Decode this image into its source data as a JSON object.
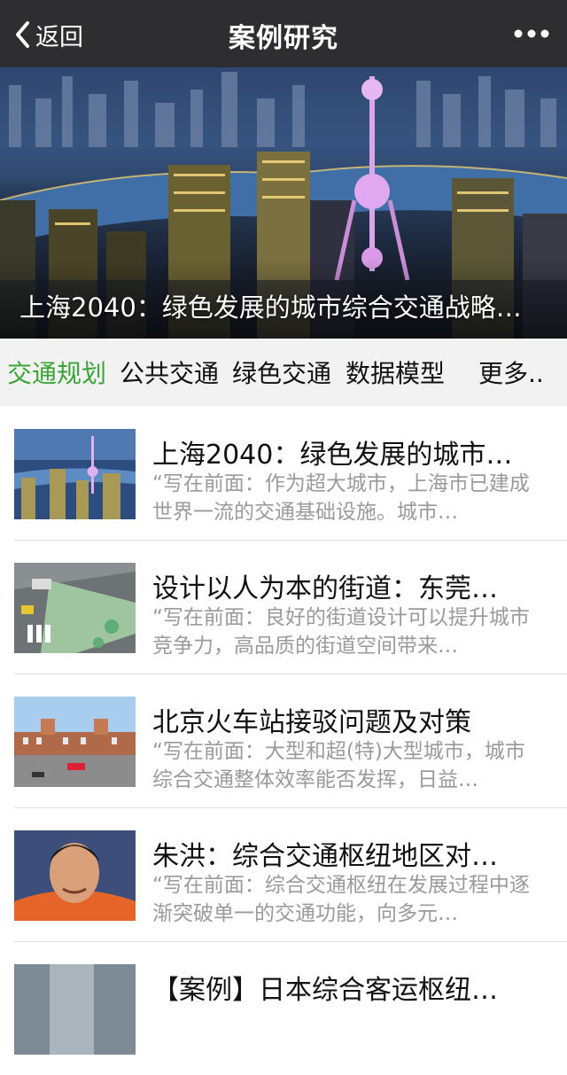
{
  "nav": {
    "back_label": "返回",
    "title": "案例研究",
    "icons": {
      "back": "chevron-left-icon",
      "more": "more-dots-icon"
    }
  },
  "banner": {
    "caption": "上海2040：绿色发展的城市综合交通战略…"
  },
  "tabs": [
    {
      "label": "交通规划",
      "active": true
    },
    {
      "label": "公共交通",
      "active": false
    },
    {
      "label": "绿色交通",
      "active": false
    },
    {
      "label": "数据模型",
      "active": false
    },
    {
      "label": "更多..",
      "active": false
    }
  ],
  "articles": [
    {
      "title": "上海2040：绿色发展的城市…",
      "summary": "“写在前面：作为超大城市，上海市已建成世界一流的交通基础设施。城市…"
    },
    {
      "title": "设计以人为本的街道：东莞…",
      "summary": "“写在前面：良好的街道设计可以提升城市竞争力，高品质的街道空间带来…"
    },
    {
      "title": "北京火车站接驳问题及对策",
      "summary": "“写在前面：大型和超(特)大型城市，城市综合交通整体效率能否发挥，日益…"
    },
    {
      "title": "朱洪：综合交通枢纽地区对…",
      "summary": "“写在前面：综合交通枢纽在发展过程中逐渐突破单一的交通功能，向多元…"
    },
    {
      "title": "【案例】日本综合客运枢纽…",
      "summary": ""
    }
  ],
  "colors": {
    "navbar": "#2e2e30",
    "active_tab": "#3aa536",
    "tab_bar": "#f2f2f2",
    "summary_text": "#9a9a9a"
  }
}
